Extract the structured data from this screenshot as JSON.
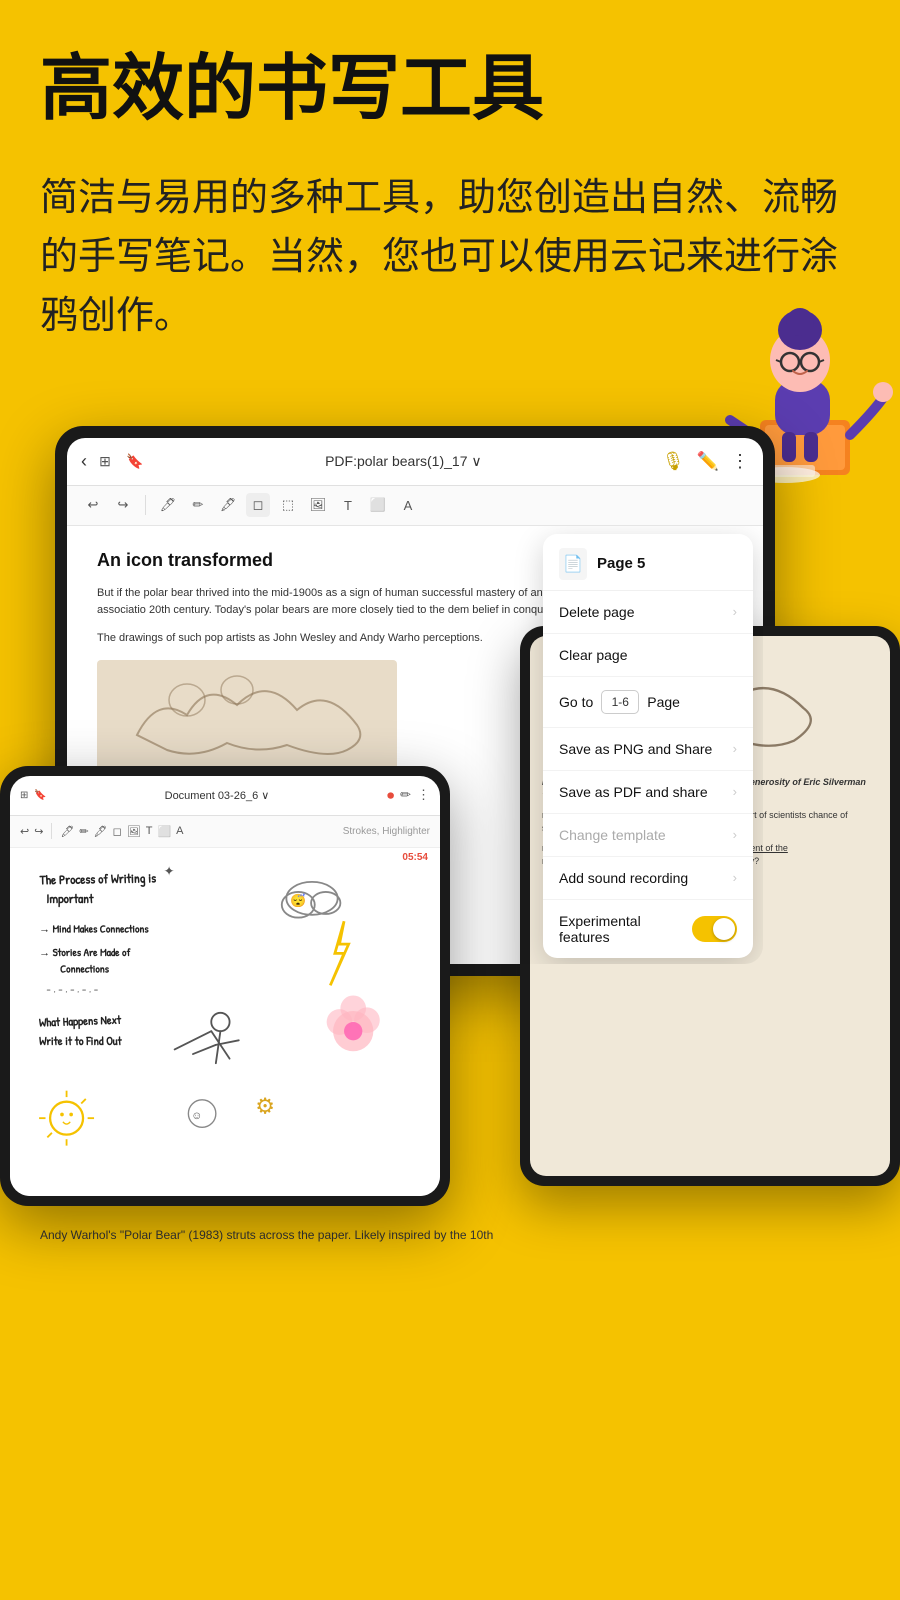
{
  "hero": {
    "title": "高效的书写工具",
    "subtitle": "简洁与易用的多种工具，助您创造出自然、流畅的手写笔记。当然，您也可以使用云记来进行涂鸦创作。"
  },
  "ipad_main": {
    "title": "PDF:polar bears(1)_17 ∨",
    "doc_title": "An icon transformed",
    "doc_body_1": "But if the polar bear thrived into the mid-1900s as a sign of human successful mastery of antagonistic forces, this symbolic associatio 20th century. Today's polar bears are more closely tied to the dem belief in conquest and domination.",
    "doc_body_2": "The drawings of such pop artists as John Wesley and Andy Warho perceptions."
  },
  "dropdown": {
    "page_label": "Page 5",
    "items": [
      {
        "label": "Delete page",
        "chevron": true,
        "disabled": false
      },
      {
        "label": "Clear page",
        "chevron": false,
        "disabled": false
      },
      {
        "label": "Go to",
        "is_goto": true,
        "goto_placeholder": "1-6",
        "goto_suffix": "Page",
        "disabled": false
      },
      {
        "label": "Save as PNG and Share",
        "chevron": true,
        "disabled": false
      },
      {
        "label": "Save as PDF and share",
        "chevron": true,
        "disabled": false
      },
      {
        "label": "Change template",
        "chevron": true,
        "disabled": true
      },
      {
        "label": "Add sound recording",
        "chevron": true,
        "disabled": false
      },
      {
        "label": "Experimental features",
        "toggle": true,
        "disabled": false
      }
    ]
  },
  "phone": {
    "title": "Document 03-26_6 ∨",
    "timer": "05:54",
    "strokes_label": "Strokes, Highlighter",
    "handwriting": [
      "The process of writing is",
      "important",
      "→ Mind makes connections",
      "→ Stories are made of",
      "    connections",
      "- - - - - - - -",
      "What happens next",
      "Write it to find out"
    ]
  },
  "secondary_doc": {
    "text_1": "mber mood. John Wesley, 'Polar Bears,' gh the generosity of Eric Silverman '85 and",
    "text_2": "rtwined bodies of polar bears r, an international cohort of scientists chance of surviving extinction if",
    "text_3": "reat white bear\" seems to echo the he U.S. Department of the raises questions about the fate of the n fact a tragedy?",
    "underline_text": "he U.S. Department of the"
  },
  "bottom": {
    "text": "Andy Warhol's \"Polar Bear\" (1983) struts across the paper. Likely inspired by the 10th"
  },
  "colors": {
    "background": "#F5C200",
    "toggle": "#F5C200",
    "mic": "#C8A000",
    "red": "#e74c3c"
  }
}
